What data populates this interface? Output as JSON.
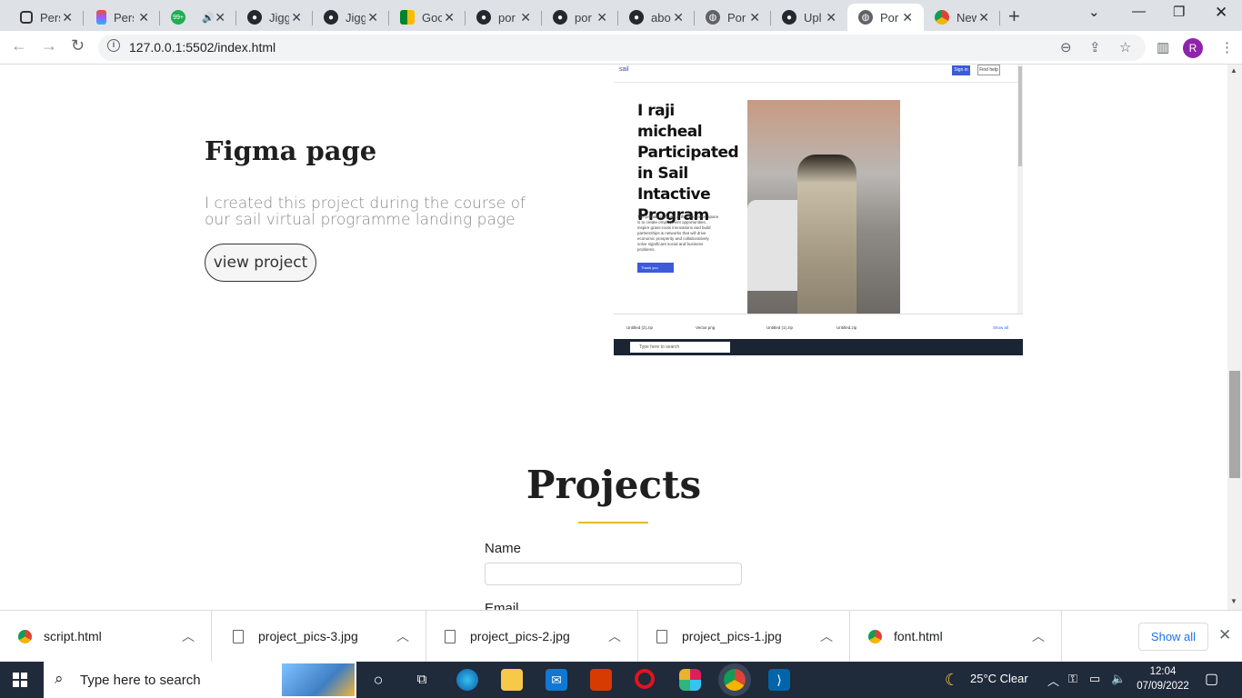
{
  "browser": {
    "tabs": [
      {
        "label": "Pers",
        "icon": "page-icon"
      },
      {
        "label": "Pers",
        "icon": "figma-icon"
      },
      {
        "label": "",
        "icon": "audio-icon",
        "badge": "99+"
      },
      {
        "label": "Jigg",
        "icon": "github-icon"
      },
      {
        "label": "Jigg",
        "icon": "github-icon"
      },
      {
        "label": "Goc",
        "icon": "google-meet-icon"
      },
      {
        "label": "por",
        "icon": "github-icon"
      },
      {
        "label": "por",
        "icon": "github-icon"
      },
      {
        "label": "abo",
        "icon": "github-icon"
      },
      {
        "label": "Por",
        "icon": "globe-icon"
      },
      {
        "label": "Upl",
        "icon": "github-icon"
      },
      {
        "label": "Por",
        "icon": "globe-icon"
      },
      {
        "label": "New",
        "icon": "chrome-icon"
      }
    ],
    "url": "127.0.0.1:5502/index.html",
    "profile_initial": "R"
  },
  "page": {
    "figma": {
      "title": "Figma page",
      "description": "I created this project during the course of our sail virtual programme landing page",
      "button": "view project"
    },
    "preview": {
      "logo": "sail",
      "signin": "Sign in",
      "findhelp": "Find help",
      "headline": "I raji micheal Participated in Sail Intactive Program",
      "body": "The primary purpose of the Innovation space is to create employment opportunities, inspire grass-roots innovations and build partnerships & networks that will drive economic prosperity and collaboratively solve significant social and business problems.",
      "thank_you": "Thank you",
      "downloads": [
        "Untitled (2).zip",
        "Vector.png",
        "Untitled (1).zip",
        "Untitled.zip"
      ],
      "show_all": "Show all",
      "taskbar_search": "Type here to search"
    },
    "projects": {
      "title": "Projects",
      "name_label": "Name",
      "email_label": "Email"
    }
  },
  "downloads": [
    {
      "name": "script.html",
      "icon": "chrome-icon"
    },
    {
      "name": "project_pics-3.jpg",
      "icon": "file-icon"
    },
    {
      "name": "project_pics-2.jpg",
      "icon": "file-icon"
    },
    {
      "name": "project_pics-1.jpg",
      "icon": "file-icon"
    },
    {
      "name": "font.html",
      "icon": "chrome-icon"
    }
  ],
  "shelf": {
    "show_all": "Show all"
  },
  "taskbar": {
    "search_placeholder": "Type here to search",
    "weather": "25°C  Clear",
    "time": "12:04",
    "date": "07/09/2022"
  }
}
